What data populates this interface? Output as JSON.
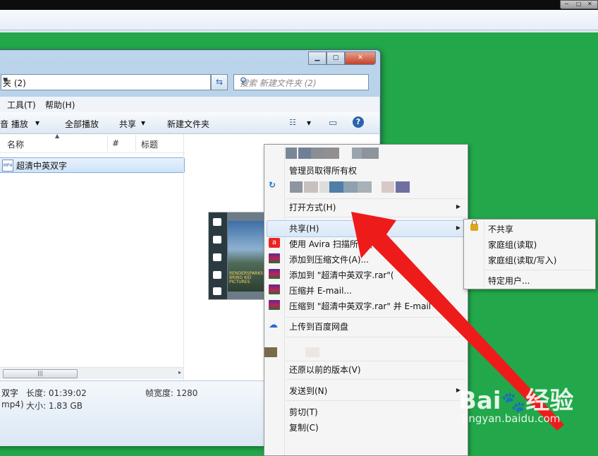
{
  "explorer": {
    "address": "夹 (2)",
    "search_placeholder": "搜索 新建文件夹 (2)",
    "menu": [
      "工具(T)",
      "帮助(H)"
    ],
    "toolbar": [
      "音 播放",
      "全部播放",
      "共享",
      "新建文件夹"
    ],
    "columns": [
      "名称",
      "#",
      "标题"
    ],
    "file_name": "超清中英双字",
    "file_icon_text": "MP4",
    "thumbnail_caption": "RENDERSPARKS BRING KID PICTURES",
    "details": {
      "name_tail": "双字",
      "ext_tail": "mp4)",
      "length_label": "长度: 01:39:02",
      "size_label": "大小: 1.83 GB",
      "framewidth_label": "帧宽度: 1280"
    }
  },
  "context_menu": {
    "items": [
      {
        "label": "管理员取得所有权"
      },
      {
        "label": "打开方式(H)",
        "submenu": true
      },
      {
        "label": "共享(H)",
        "submenu": true,
        "highlighted": true
      },
      {
        "label": "使用 Avira 扫描所",
        "tail": "件(V)"
      },
      {
        "label": "添加到压缩文件(A)..."
      },
      {
        "label": "添加到 \"超清中英双字.rar\"(",
        "tail": ")"
      },
      {
        "label": "压缩并 E-mail..."
      },
      {
        "label": "压缩到 \"超清中英双字.rar\" 并 E-mail"
      },
      {
        "label": "上传到百度网盘"
      },
      {
        "label": "还原以前的版本(V)"
      },
      {
        "label": "发送到(N)",
        "submenu": true
      },
      {
        "label": "剪切(T)"
      },
      {
        "label": "复制(C)"
      }
    ]
  },
  "share_submenu": {
    "items": [
      "不共享",
      "家庭组(读取)",
      "家庭组(读取/写入)",
      "特定用户..."
    ]
  },
  "watermark": {
    "brand": "Bai",
    "brand2": "经验",
    "url": "jingyan.baidu.com"
  },
  "colors": {
    "desktop": "#22a84a",
    "arrow": "#ee1b1b"
  }
}
